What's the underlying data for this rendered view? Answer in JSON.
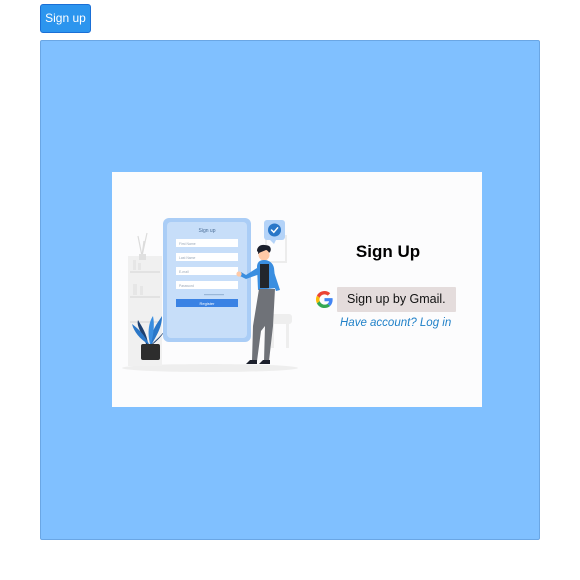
{
  "open_button": {
    "label": "Sign up"
  },
  "signup_modal": {
    "title": "Sign Up",
    "gmail_button_label": "Sign up by Gmail.",
    "login_link": "Have account? Log in",
    "illustration": {
      "icon": "signup-illustration",
      "form_title": "Sign up",
      "fields": [
        "First Name",
        "Last Name",
        "E-mail",
        "Password"
      ],
      "submit_label": "Register"
    }
  },
  "colors": {
    "overlay_bg": "#80c0ff",
    "button_bg": "#2c95ee",
    "gmail_button_bg": "#e4dcdc",
    "link": "#1f80c8"
  }
}
